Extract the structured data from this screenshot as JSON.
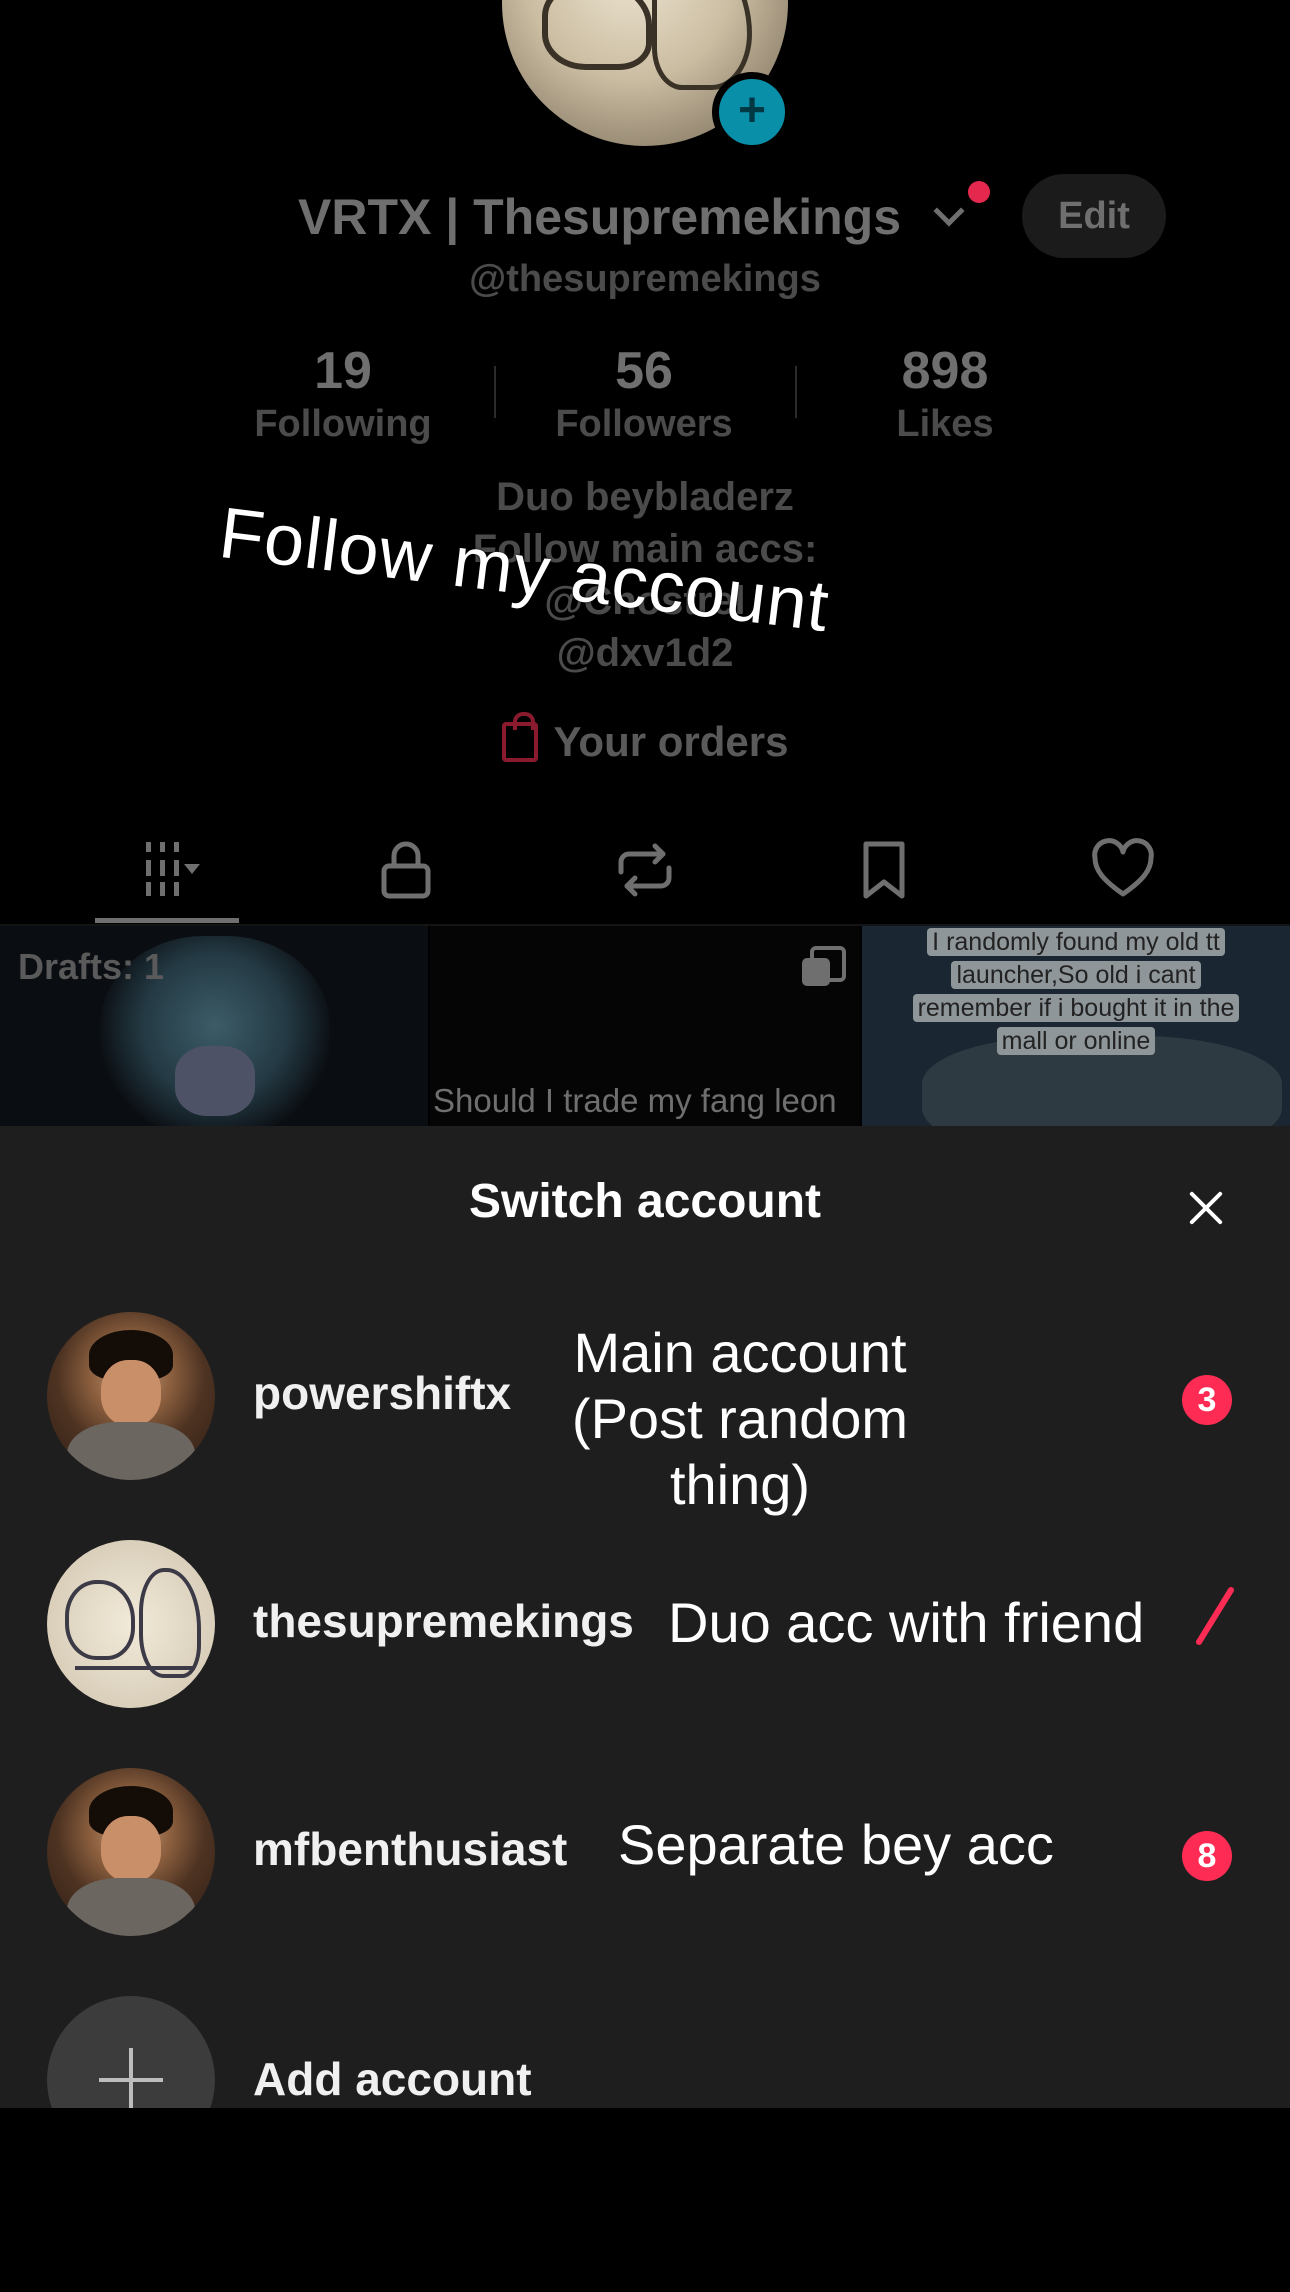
{
  "profile": {
    "display_name": "VRTX | Thesupremekings",
    "handle": "@thesupremekings",
    "edit_label": "Edit",
    "stats": [
      {
        "value": "19",
        "label": "Following"
      },
      {
        "value": "56",
        "label": "Followers"
      },
      {
        "value": "898",
        "label": "Likes"
      }
    ],
    "bio": [
      "Duo beybladerz",
      "Follow main accs:",
      "@Chostrel",
      "@dxv1d2"
    ],
    "orders_label": "Your orders",
    "tabs": [
      "videos-grid-icon",
      "lock-icon",
      "repost-icon",
      "bookmark-icon",
      "heart-icon"
    ]
  },
  "overlay_caption": "Follow my account",
  "grid": {
    "drafts_label": "Drafts: 1",
    "video2_caption": "Should I trade my fang leon",
    "video3_caption_lines": [
      "I randomly found my old tt",
      "launcher,So old i cant",
      "remember if i bought it in the",
      "mall or online"
    ]
  },
  "sheet": {
    "title": "Switch account",
    "accounts": [
      {
        "username": "powershiftx",
        "note_lines": [
          "Main account",
          "(Post random",
          "thing)"
        ],
        "badge": "3"
      },
      {
        "username": "thesupremekings",
        "note_lines": [
          "Duo acc with friend"
        ],
        "selected": true
      },
      {
        "username": "mfbenthusiast",
        "note_lines": [
          "Separate bey acc"
        ],
        "badge": "8"
      }
    ],
    "add_label": "Add account"
  },
  "colors": {
    "accent_red": "#fe2c55",
    "sheet_bg": "#1e1e1e",
    "plus_teal": "#0a8fa8"
  }
}
